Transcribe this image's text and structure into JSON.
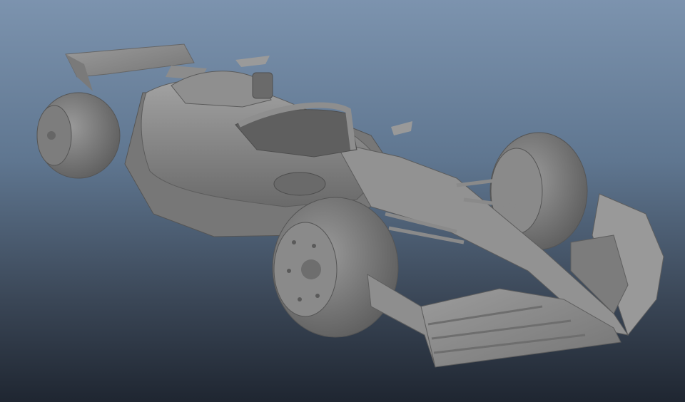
{
  "viewport": {
    "subject": "f1-car-model",
    "shading": "smooth-gray",
    "colors": {
      "background_top": "#7c93ae",
      "background_bottom": "#1f2631",
      "model": "#8a8a8a",
      "model_shadow": "#5e5e5e",
      "model_highlight": "#a8a8a8"
    }
  }
}
